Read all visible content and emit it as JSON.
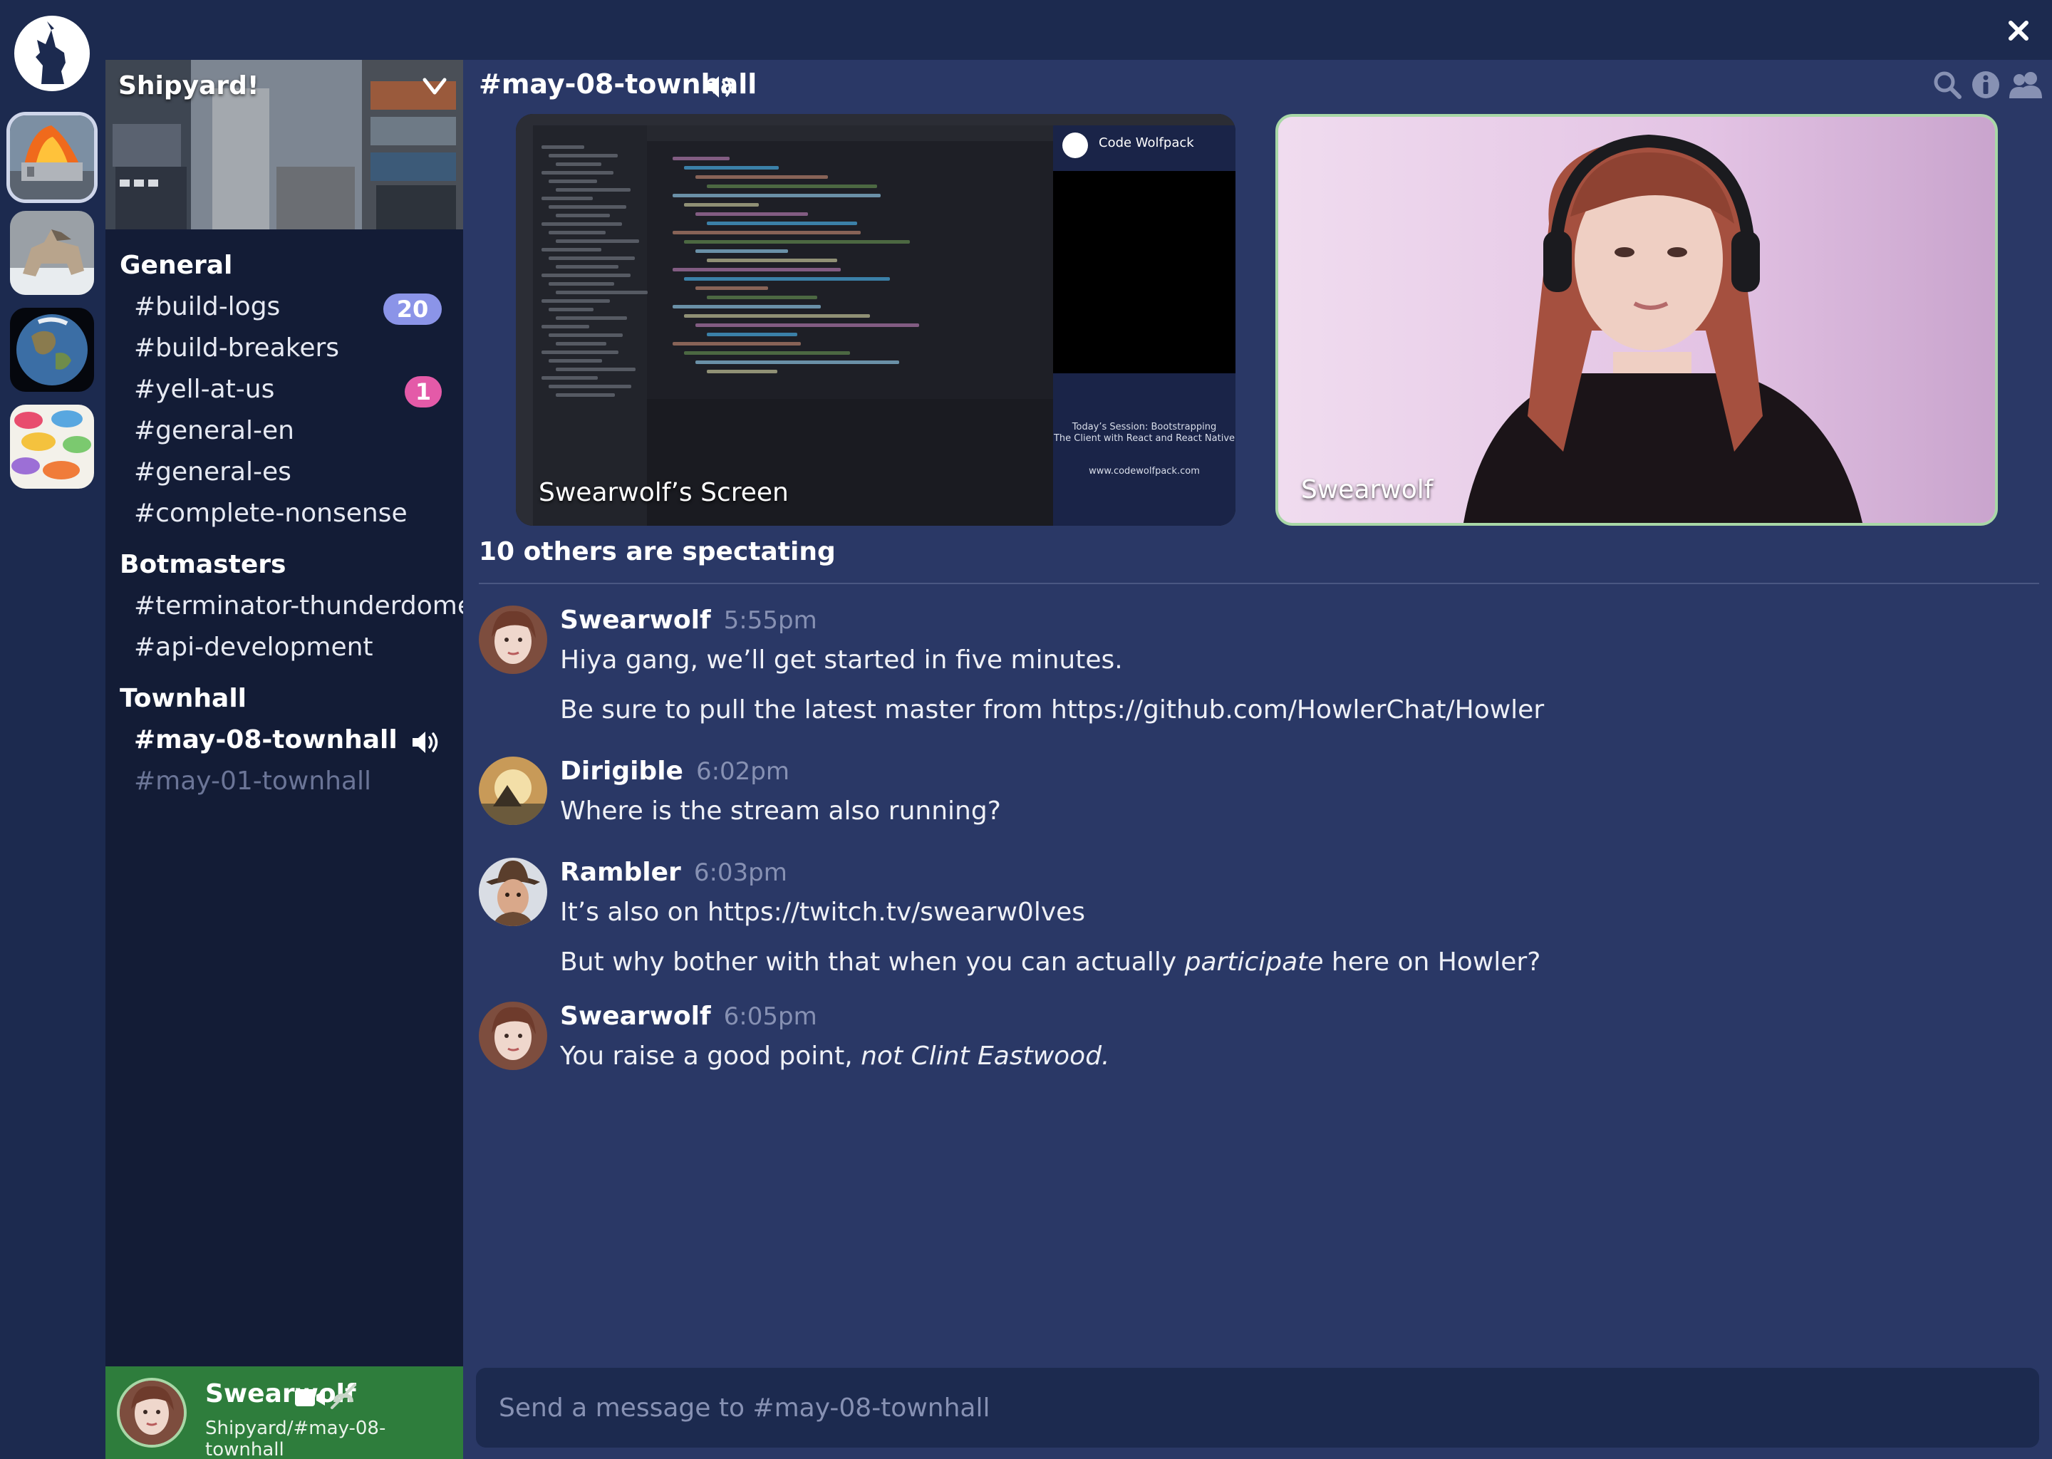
{
  "window": {
    "close_icon": "close-icon"
  },
  "servers": [
    {
      "name": "burning-container-server",
      "active": true
    },
    {
      "name": "wolf-server",
      "active": false
    },
    {
      "name": "earth-server",
      "active": false
    },
    {
      "name": "speech-bubbles-server",
      "active": false
    }
  ],
  "sidebar": {
    "server_name": "Shipyard!",
    "categories": [
      {
        "name": "General",
        "channels": [
          {
            "label": "#build-logs",
            "badge": "20",
            "badge_color": "#8b94e8"
          },
          {
            "label": "#build-breakers"
          },
          {
            "label": "#yell-at-us",
            "badge": "1",
            "badge_color": "#e45aa8"
          },
          {
            "label": "#general-en"
          },
          {
            "label": "#general-es"
          },
          {
            "label": "#complete-nonsense"
          }
        ]
      },
      {
        "name": "Botmasters",
        "channels": [
          {
            "label": "#terminator-thunderdome"
          },
          {
            "label": "#api-development"
          }
        ]
      },
      {
        "name": "Townhall",
        "channels": [
          {
            "label": "#may-08-townhall",
            "active": true,
            "voice": true
          },
          {
            "label": "#may-01-townhall",
            "dim": true
          }
        ]
      }
    ]
  },
  "user_panel": {
    "name": "Swearwolf",
    "location": "Shipyard/#may-08-townhall"
  },
  "main": {
    "channel_title": "#may-08-townhall",
    "tiles": {
      "screen_label": "Swearwolf’s Screen",
      "screen_brand": "Code Wolfpack",
      "screen_session_1": "Today’s Session: Bootstrapping",
      "screen_session_2": "The Client with React and React Native",
      "screen_url": "www.codewolfpack.com",
      "camera_label": "Swearwolf"
    },
    "spectating": "10 others are spectating",
    "messages": [
      {
        "author": "Swearwolf",
        "time": "5:55pm",
        "lines": [
          "Hiya gang, we’ll get started in five minutes.",
          "Be sure to pull the latest master from https://github.com/HowlerChat/Howler"
        ]
      },
      {
        "author": "Dirigible",
        "time": "6:02pm",
        "lines": [
          "Where is the stream also running?"
        ]
      },
      {
        "author": "Rambler",
        "time": "6:03pm",
        "lines": [
          "It’s also on https://twitch.tv/swearw0lves"
        ],
        "line2_pre": "But why bother with that when you can actually ",
        "line2_em": "participate",
        "line2_post": " here on Howler?"
      },
      {
        "author": "Swearwolf",
        "time": "6:05pm",
        "line1_pre": "You raise a good point, ",
        "line1_em": "not Clint Eastwood."
      }
    ],
    "composer_placeholder": "Send a message to #may-08-townhall"
  },
  "colors": {
    "background": "#1c2a4f",
    "sidebar": "#131c36",
    "main": "#2a3866",
    "user_panel": "#2e7d3c",
    "camera_border": "#a8d7a6"
  }
}
